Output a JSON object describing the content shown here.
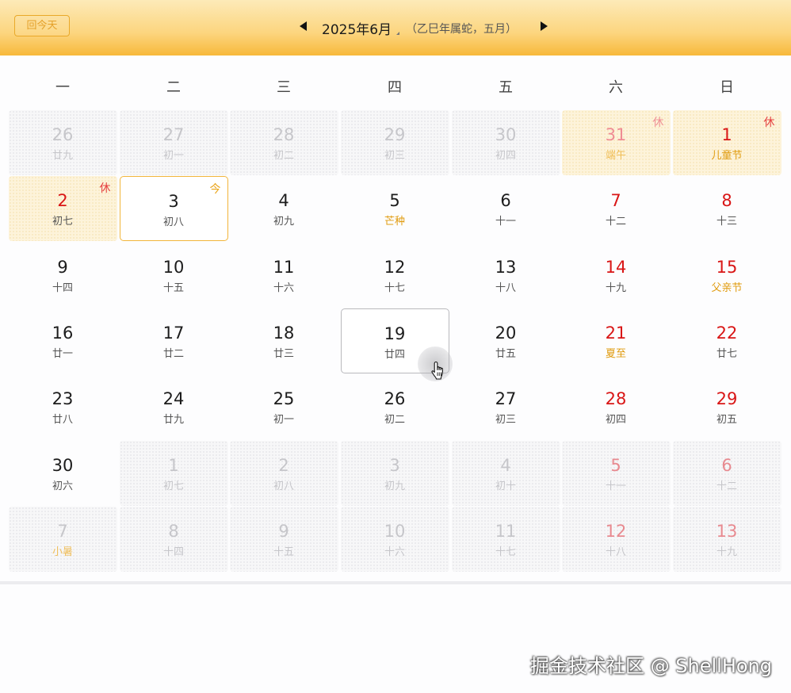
{
  "header": {
    "today_button": "回今天",
    "month_title": "2025年6月",
    "lunar_year": "（乙巳年属蛇，五月）"
  },
  "weekdays": [
    "一",
    "二",
    "三",
    "四",
    "五",
    "六",
    "日"
  ],
  "grid": [
    [
      {
        "solar": "26",
        "lunar": "廿九",
        "other": true
      },
      {
        "solar": "27",
        "lunar": "初一",
        "other": true
      },
      {
        "solar": "28",
        "lunar": "初二",
        "other": true
      },
      {
        "solar": "29",
        "lunar": "初三",
        "other": true
      },
      {
        "solar": "30",
        "lunar": "初四",
        "other": true
      },
      {
        "solar": "31",
        "lunar": "端午",
        "other": true,
        "weekend": true,
        "holiday": true,
        "badge": "休",
        "festival": true
      },
      {
        "solar": "1",
        "lunar": "儿童节",
        "weekend": true,
        "holiday": true,
        "badge": "休",
        "festival": true
      }
    ],
    [
      {
        "solar": "2",
        "lunar": "初七",
        "holiday": true,
        "badge": "休"
      },
      {
        "solar": "3",
        "lunar": "初八",
        "today": true,
        "badge": "今"
      },
      {
        "solar": "4",
        "lunar": "初九"
      },
      {
        "solar": "5",
        "lunar": "芒种",
        "festival": true
      },
      {
        "solar": "6",
        "lunar": "十一"
      },
      {
        "solar": "7",
        "lunar": "十二",
        "weekend": true
      },
      {
        "solar": "8",
        "lunar": "十三",
        "weekend": true
      }
    ],
    [
      {
        "solar": "9",
        "lunar": "十四"
      },
      {
        "solar": "10",
        "lunar": "十五"
      },
      {
        "solar": "11",
        "lunar": "十六"
      },
      {
        "solar": "12",
        "lunar": "十七"
      },
      {
        "solar": "13",
        "lunar": "十八"
      },
      {
        "solar": "14",
        "lunar": "十九",
        "weekend": true
      },
      {
        "solar": "15",
        "lunar": "父亲节",
        "weekend": true,
        "festival": true
      }
    ],
    [
      {
        "solar": "16",
        "lunar": "廿一"
      },
      {
        "solar": "17",
        "lunar": "廿二"
      },
      {
        "solar": "18",
        "lunar": "廿三"
      },
      {
        "solar": "19",
        "lunar": "廿四",
        "hovered": true
      },
      {
        "solar": "20",
        "lunar": "廿五"
      },
      {
        "solar": "21",
        "lunar": "夏至",
        "weekend": true,
        "festival": true
      },
      {
        "solar": "22",
        "lunar": "廿七",
        "weekend": true
      }
    ],
    [
      {
        "solar": "23",
        "lunar": "廿八"
      },
      {
        "solar": "24",
        "lunar": "廿九"
      },
      {
        "solar": "25",
        "lunar": "初一"
      },
      {
        "solar": "26",
        "lunar": "初二"
      },
      {
        "solar": "27",
        "lunar": "初三"
      },
      {
        "solar": "28",
        "lunar": "初四",
        "weekend": true
      },
      {
        "solar": "29",
        "lunar": "初五",
        "weekend": true
      }
    ],
    [
      {
        "solar": "30",
        "lunar": "初六"
      },
      {
        "solar": "1",
        "lunar": "初七",
        "other": true
      },
      {
        "solar": "2",
        "lunar": "初八",
        "other": true
      },
      {
        "solar": "3",
        "lunar": "初九",
        "other": true
      },
      {
        "solar": "4",
        "lunar": "初十",
        "other": true
      },
      {
        "solar": "5",
        "lunar": "十一",
        "other": true,
        "weekend": true
      },
      {
        "solar": "6",
        "lunar": "十二",
        "other": true,
        "weekend": true
      }
    ],
    [
      {
        "solar": "7",
        "lunar": "小暑",
        "other": true,
        "festival": true
      },
      {
        "solar": "8",
        "lunar": "十四",
        "other": true
      },
      {
        "solar": "9",
        "lunar": "十五",
        "other": true
      },
      {
        "solar": "10",
        "lunar": "十六",
        "other": true
      },
      {
        "solar": "11",
        "lunar": "十七",
        "other": true
      },
      {
        "solar": "12",
        "lunar": "十八",
        "other": true,
        "weekend": true
      },
      {
        "solar": "13",
        "lunar": "十九",
        "other": true,
        "weekend": true
      }
    ]
  ],
  "watermark": "掘金技术社区 @ ShellHong"
}
